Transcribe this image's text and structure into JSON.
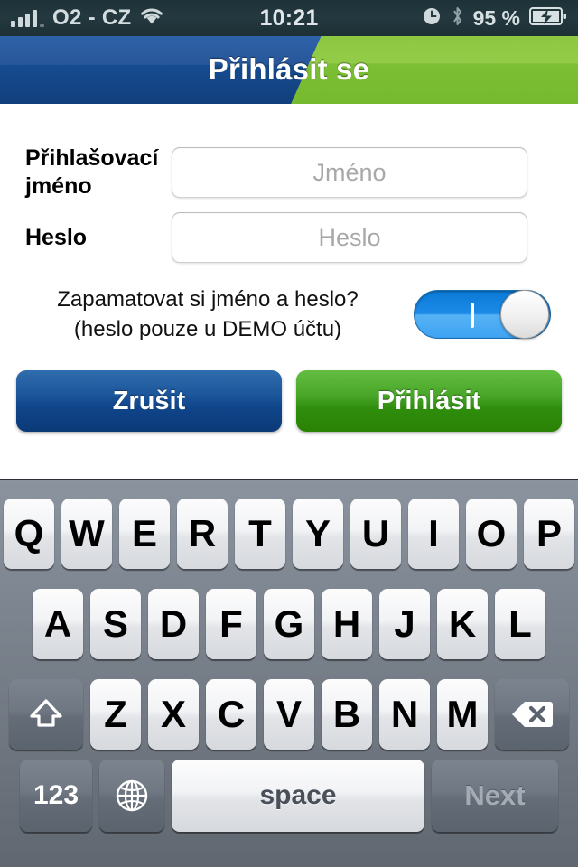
{
  "status_bar": {
    "carrier": "O2 - CZ",
    "time": "10:21",
    "battery_percent": "95 %",
    "icons": {
      "signal": "signal-bars-icon",
      "wifi": "wifi-icon",
      "alarm": "alarm-clock-icon",
      "bluetooth": "bluetooth-icon",
      "battery": "battery-charging-icon"
    }
  },
  "navbar": {
    "title": "Přihlásit se",
    "bg_blue": "#154c90",
    "accent_green": "#8cc63f"
  },
  "form": {
    "username": {
      "label": "Přihlašovací jméno",
      "placeholder": "Jméno",
      "value": ""
    },
    "password": {
      "label": "Heslo",
      "placeholder": "Heslo",
      "value": ""
    },
    "remember": {
      "line1": "Zapamatovat si jméno a heslo?",
      "line2": "(heslo pouze u DEMO účtu)",
      "toggle_state": "on"
    },
    "buttons": {
      "cancel": "Zrušit",
      "submit": "Přihlásit",
      "cancel_color": "#1d579c",
      "submit_color": "#2f8d0c"
    }
  },
  "keyboard": {
    "row1": [
      "Q",
      "W",
      "E",
      "R",
      "T",
      "Y",
      "U",
      "I",
      "O",
      "P"
    ],
    "row2": [
      "A",
      "S",
      "D",
      "F",
      "G",
      "H",
      "J",
      "K",
      "L"
    ],
    "row3": [
      "Z",
      "X",
      "C",
      "V",
      "B",
      "N",
      "M"
    ],
    "shift": "shift-icon",
    "backspace": "backspace-icon",
    "numeric": "123",
    "globe": "globe-icon",
    "space": "space",
    "next": "Next"
  }
}
